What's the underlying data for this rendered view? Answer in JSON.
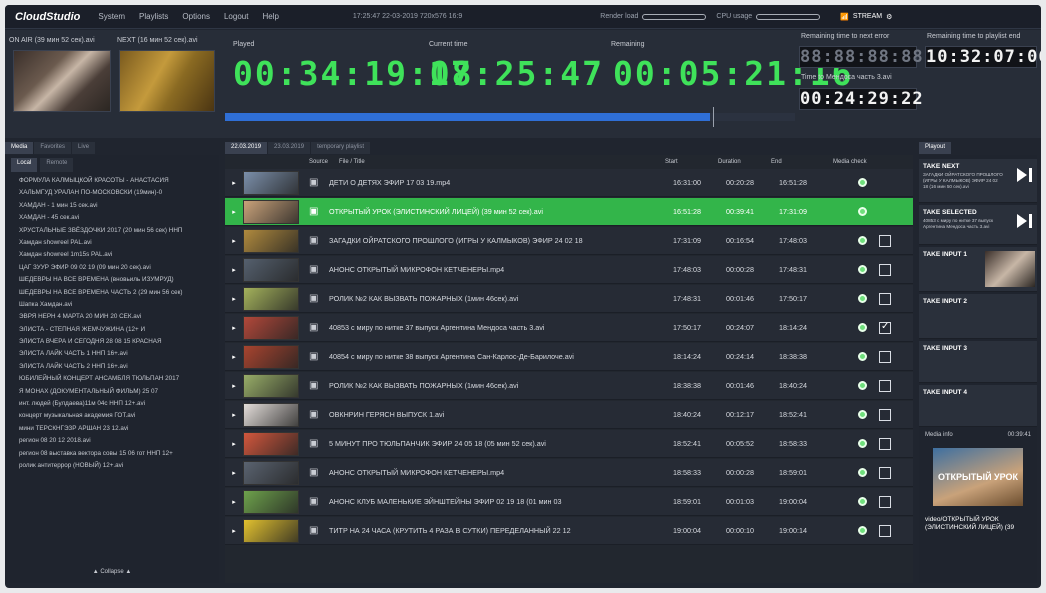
{
  "app": {
    "brand": "CloudStudio"
  },
  "menu": [
    "System",
    "Playlists",
    "Options",
    "Logout",
    "Help"
  ],
  "status": {
    "clock": "17:25:47 22-03-2019 720x576 16:9",
    "render_label": "Render load",
    "cpu_label": "CPU usage",
    "stream_label": "STREAM"
  },
  "top": {
    "on_air_label": "ON AIR (39 мин 52 сек).avi",
    "next_label": "NEXT (16 мин 52 сек).avi",
    "played_label": "Played",
    "played_value": "00:34:19:08",
    "current_label": "Current time",
    "current_value": "17:25:47",
    "remaining_label": "Remaining",
    "remaining_value": "00:05:21:16",
    "progress_fraction": 0.85,
    "next_error_label": "Remaining time to next error",
    "next_error_value": "88:88:88:88",
    "playlist_end_label": "Remaining time to playlist end",
    "playlist_end_value": "10:32:07:06",
    "mendoza_label": "Time to Мендоса часть 3.avi",
    "mendoza_value": "00:24:29:22"
  },
  "left": {
    "tabs": [
      "Media",
      "Favorites",
      "Live"
    ],
    "subtabs": [
      "Local",
      "Remote"
    ],
    "items": [
      "ФОРМУЛА КАЛМЫЦКОЙ КРАСОТЫ - АНАСТАСИЯ",
      "ХАЛЬМГУД УРАЛАН ПО-МОСКОВСКИ (19мин)-0",
      "ХАМДАН - 1 мин 15 сек.avi",
      "ХАМДАН - 45 сек.avi",
      "ХРУСТАЛЬНЫЕ ЗВЁЗДОЧКИ 2017 (20 мин 56 сек) ННП",
      "Хамдан showreel PAL.avi",
      "Хамдан showreel 1m15s PAL.avi",
      "ЦАГ ЗУУР ЭФИР 09 02 19 (09 мин 20 сек).avi",
      "ШЕДЕВРЫ НА ВСЕ ВРЕМЕНА (вновьиль ИЗУМРУД)",
      "ШЕДЕВРЫ НА ВСЕ ВРЕМЕНА ЧАСТЬ 2 (29 мин 56 сек)",
      "Шапка Хамдан.avi",
      "ЭВРЯ НЕРН 4 МАРТА 20 МИН 20 СЕК.avi",
      "ЭЛИСТА - СТЕПНАЯ ЖЕМЧУЖИНА (12+ И",
      "ЭЛИСТА ВЧЕРА И СЕГОДНЯ 28 08 15 КРАСНАЯ",
      "ЭЛИСТА ЛАЙК ЧАСТЬ 1 ННП 16+.avi",
      "ЭЛИСТА ЛАЙК ЧАСТЬ 2 ННП 16+.avi",
      "ЮБИЛЕЙНЫЙ КОНЦЕРТ АНСАМБЛЯ ТЮЛЬПАН 2017",
      "Я МОНАХ (ДОКУМЕНТАЛЬНЫЙ ФИЛЬМ) 25 07",
      "инт. людей (Булдаева)11м 04с ННП 12+.avi",
      "концерт музыкальная академия ГОТ.avi",
      "мини ТЕРСКНГЭЗР АРШАН 23 12.avi",
      "регион 08 20 12 2018.avi",
      "регион 08 выставка вектора совы 15 06 гот ННП 12+",
      "ролик антитеррор (НОВЫЙ) 12+.avi"
    ],
    "collapse_label": "▲ Collapse ▲"
  },
  "playlist": {
    "tabs": [
      "22.03.2019",
      "23.03.2019",
      "temporary playlist"
    ],
    "headers": {
      "source": "Source",
      "file": "File / Title",
      "start": "Start",
      "duration": "Duration",
      "end": "End",
      "check": "Media check"
    },
    "rows": [
      {
        "title": "ДЕТИ О ДЕТЯХ ЭФИР 17 03 19.mp4",
        "start": "16:31:00",
        "duration": "00:20:28",
        "end": "16:51:28",
        "checkbox": false,
        "active": false,
        "thumb": "#7b8faa"
      },
      {
        "title": "ОТКРЫТЫЙ УРОК (ЭЛИСТИНСКИЙ ЛИЦЕЙ) (39 мин 52 сек).avi",
        "start": "16:51:28",
        "duration": "00:39:41",
        "end": "17:31:09",
        "checkbox": false,
        "active": true,
        "thumb": "#c9a27a"
      },
      {
        "title": "ЗАГАДКИ ОЙРАТСКОГО ПРОШЛОГО (ИГРЫ У КАЛМЫКОВ) ЭФИР 24 02 18",
        "start": "17:31:09",
        "duration": "00:16:54",
        "end": "17:48:03",
        "checkbox": true,
        "active": false,
        "thumb": "#b08a3e"
      },
      {
        "title": "АНОНС ОТКРЫТЫЙ МИКРОФОН КЕТЧЕНЕРЫ.mp4",
        "start": "17:48:03",
        "duration": "00:00:28",
        "end": "17:48:31",
        "checkbox": true,
        "active": false,
        "thumb": "#55606e"
      },
      {
        "title": "РОЛИК №2 КАК ВЫЗВАТЬ ПОЖАРНЫХ (1мин 46сек).avi",
        "start": "17:48:31",
        "duration": "00:01:46",
        "end": "17:50:17",
        "checkbox": true,
        "active": false,
        "thumb": "#a4b25c"
      },
      {
        "title": "40853 с миру по нитке 37 выпуск Аргентина Мендоса часть 3.avi",
        "start": "17:50:17",
        "duration": "00:24:07",
        "end": "18:14:24",
        "checkbox": true,
        "checked": true,
        "active": false,
        "thumb": "#b2483a"
      },
      {
        "title": "40854 с миру по нитке 38 выпуск Аргентина Сан-Карлос-Де-Барилоче.avi",
        "start": "18:14:24",
        "duration": "00:24:14",
        "end": "18:38:38",
        "checkbox": true,
        "active": false,
        "thumb": "#a8442f"
      },
      {
        "title": "РОЛИК №2 КАК ВЫЗВАТЬ ПОЖАРНЫХ (1мин 46сек).avi",
        "start": "18:38:38",
        "duration": "00:01:46",
        "end": "18:40:24",
        "checkbox": true,
        "active": false,
        "thumb": "#98ad68"
      },
      {
        "title": "ОВКНРИН ГЕРЯСН ВЫПУСК 1.avi",
        "start": "18:40:24",
        "duration": "00:12:17",
        "end": "18:52:41",
        "checkbox": true,
        "active": false,
        "thumb": "#e3ddd9"
      },
      {
        "title": "5 МИНУТ ПРО ТЮЛЬПАНЧИК ЭФИР 24 05 18 (05 мин 52 сек).avi",
        "start": "18:52:41",
        "duration": "00:05:52",
        "end": "18:58:33",
        "checkbox": true,
        "active": false,
        "thumb": "#d2573d"
      },
      {
        "title": "АНОНС ОТКРЫТЫЙ МИКРОФОН КЕТЧЕНЕРЫ.mp4",
        "start": "18:58:33",
        "duration": "00:00:28",
        "end": "18:59:01",
        "checkbox": true,
        "active": false,
        "thumb": "#5a6370"
      },
      {
        "title": "АНОНС КЛУБ МАЛЕНЬКИЕ ЭЙНШТЕЙНЫ ЭФИР 02 19 18 (01 мин 03",
        "start": "18:59:01",
        "duration": "00:01:03",
        "end": "19:00:04",
        "checkbox": true,
        "active": false,
        "thumb": "#6ea24c"
      },
      {
        "title": "ТИТР НА 24 ЧАСА (КРУТИТЬ 4 РАЗА В СУТКИ) ПЕРЕДЕЛАННЫЙ 22 12",
        "start": "19:00:04",
        "duration": "00:00:10",
        "end": "19:00:14",
        "checkbox": true,
        "active": false,
        "thumb": "#e2c12f"
      }
    ]
  },
  "right": {
    "tab": "Playout",
    "take_next_title": "TAKE NEXT",
    "take_next_sub": "ЗАГАДКИ ОЙРАТСКОГО ПРОШЛОГО (ИГРЫ У КАЛМЫКОВ) ЭФИР 24 02 18 (16 мин 50 сек).avi",
    "take_selected_title": "TAKE SELECTED",
    "take_selected_sub": "40853 с миру по нитке 37 выпуск Аргентина Мендоса часть 3.avi",
    "inputs": [
      "TAKE INPUT 1",
      "TAKE INPUT 2",
      "TAKE INPUT 3",
      "TAKE INPUT 4"
    ],
    "media_info_label": "Media info",
    "media_info_duration": "00:39:41",
    "media_info_desc": "video/ОТКРЫТЫЙ УРОК (ЭЛИСТИНСКИЙ ЛИЦЕЙ) (39",
    "media_info_caption": "ОТКРЫТЫЙ УРОК"
  }
}
